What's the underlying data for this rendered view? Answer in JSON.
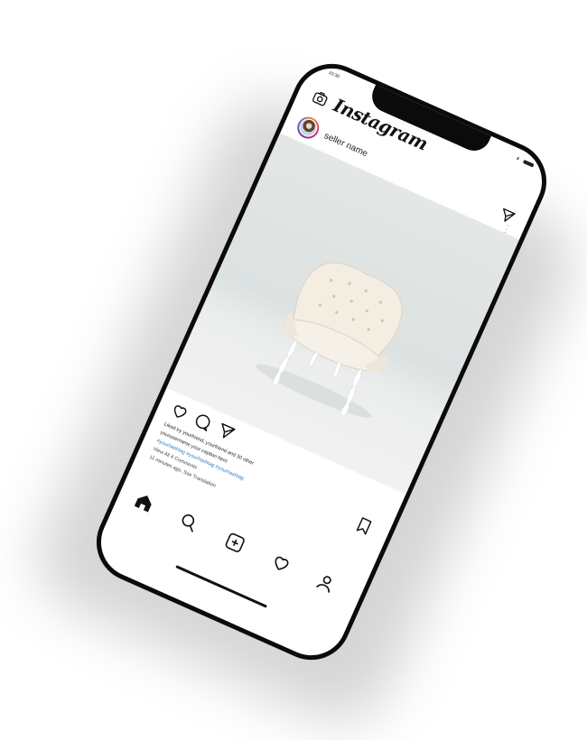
{
  "status_bar": {
    "time": "10:30",
    "signal": "ıııl"
  },
  "app": {
    "title": "Instagram"
  },
  "post": {
    "seller_name": "seller name",
    "likes_text": "Liked by yourfriend, yourfriend and 30 other",
    "caption": "yourusername your caption here",
    "hashtags": "#yourhashtag #yourhashtag #yourhashtag",
    "comments_link": "View All 4 Comments",
    "timestamp": "11 minutes ago. See Translation"
  },
  "icons": {
    "camera": "camera-icon",
    "send": "paper-plane-icon",
    "more": "more-vertical-icon",
    "like": "heart-icon",
    "comment": "comment-icon",
    "share": "paper-plane-icon",
    "save": "bookmark-icon",
    "home": "home-icon",
    "search": "search-icon",
    "add": "add-post-icon",
    "activity": "heart-icon",
    "profile": "profile-icon"
  },
  "colors": {
    "hashtag": "#2e7cc1",
    "phone_frame": "#0b0b0b",
    "photo_background": "#e3e7e6"
  }
}
